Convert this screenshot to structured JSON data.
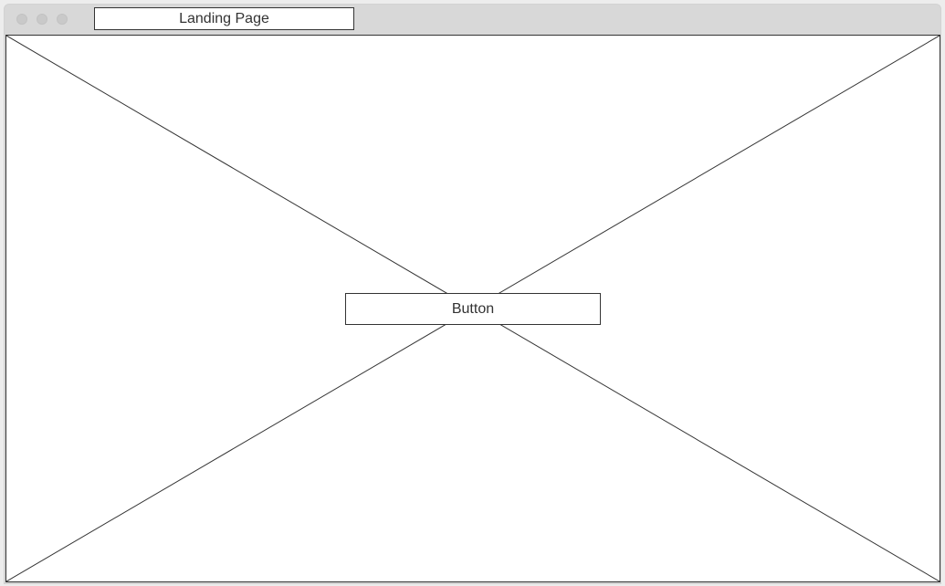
{
  "window": {
    "tab_title": "Landing Page"
  },
  "main": {
    "button_label": "Button",
    "image_placeholder": "image-placeholder-icon"
  },
  "colors": {
    "frame": "#d8d8d8",
    "stroke": "#333333",
    "content_bg": "#ffffff",
    "traffic_light": "#c9c9c9"
  }
}
